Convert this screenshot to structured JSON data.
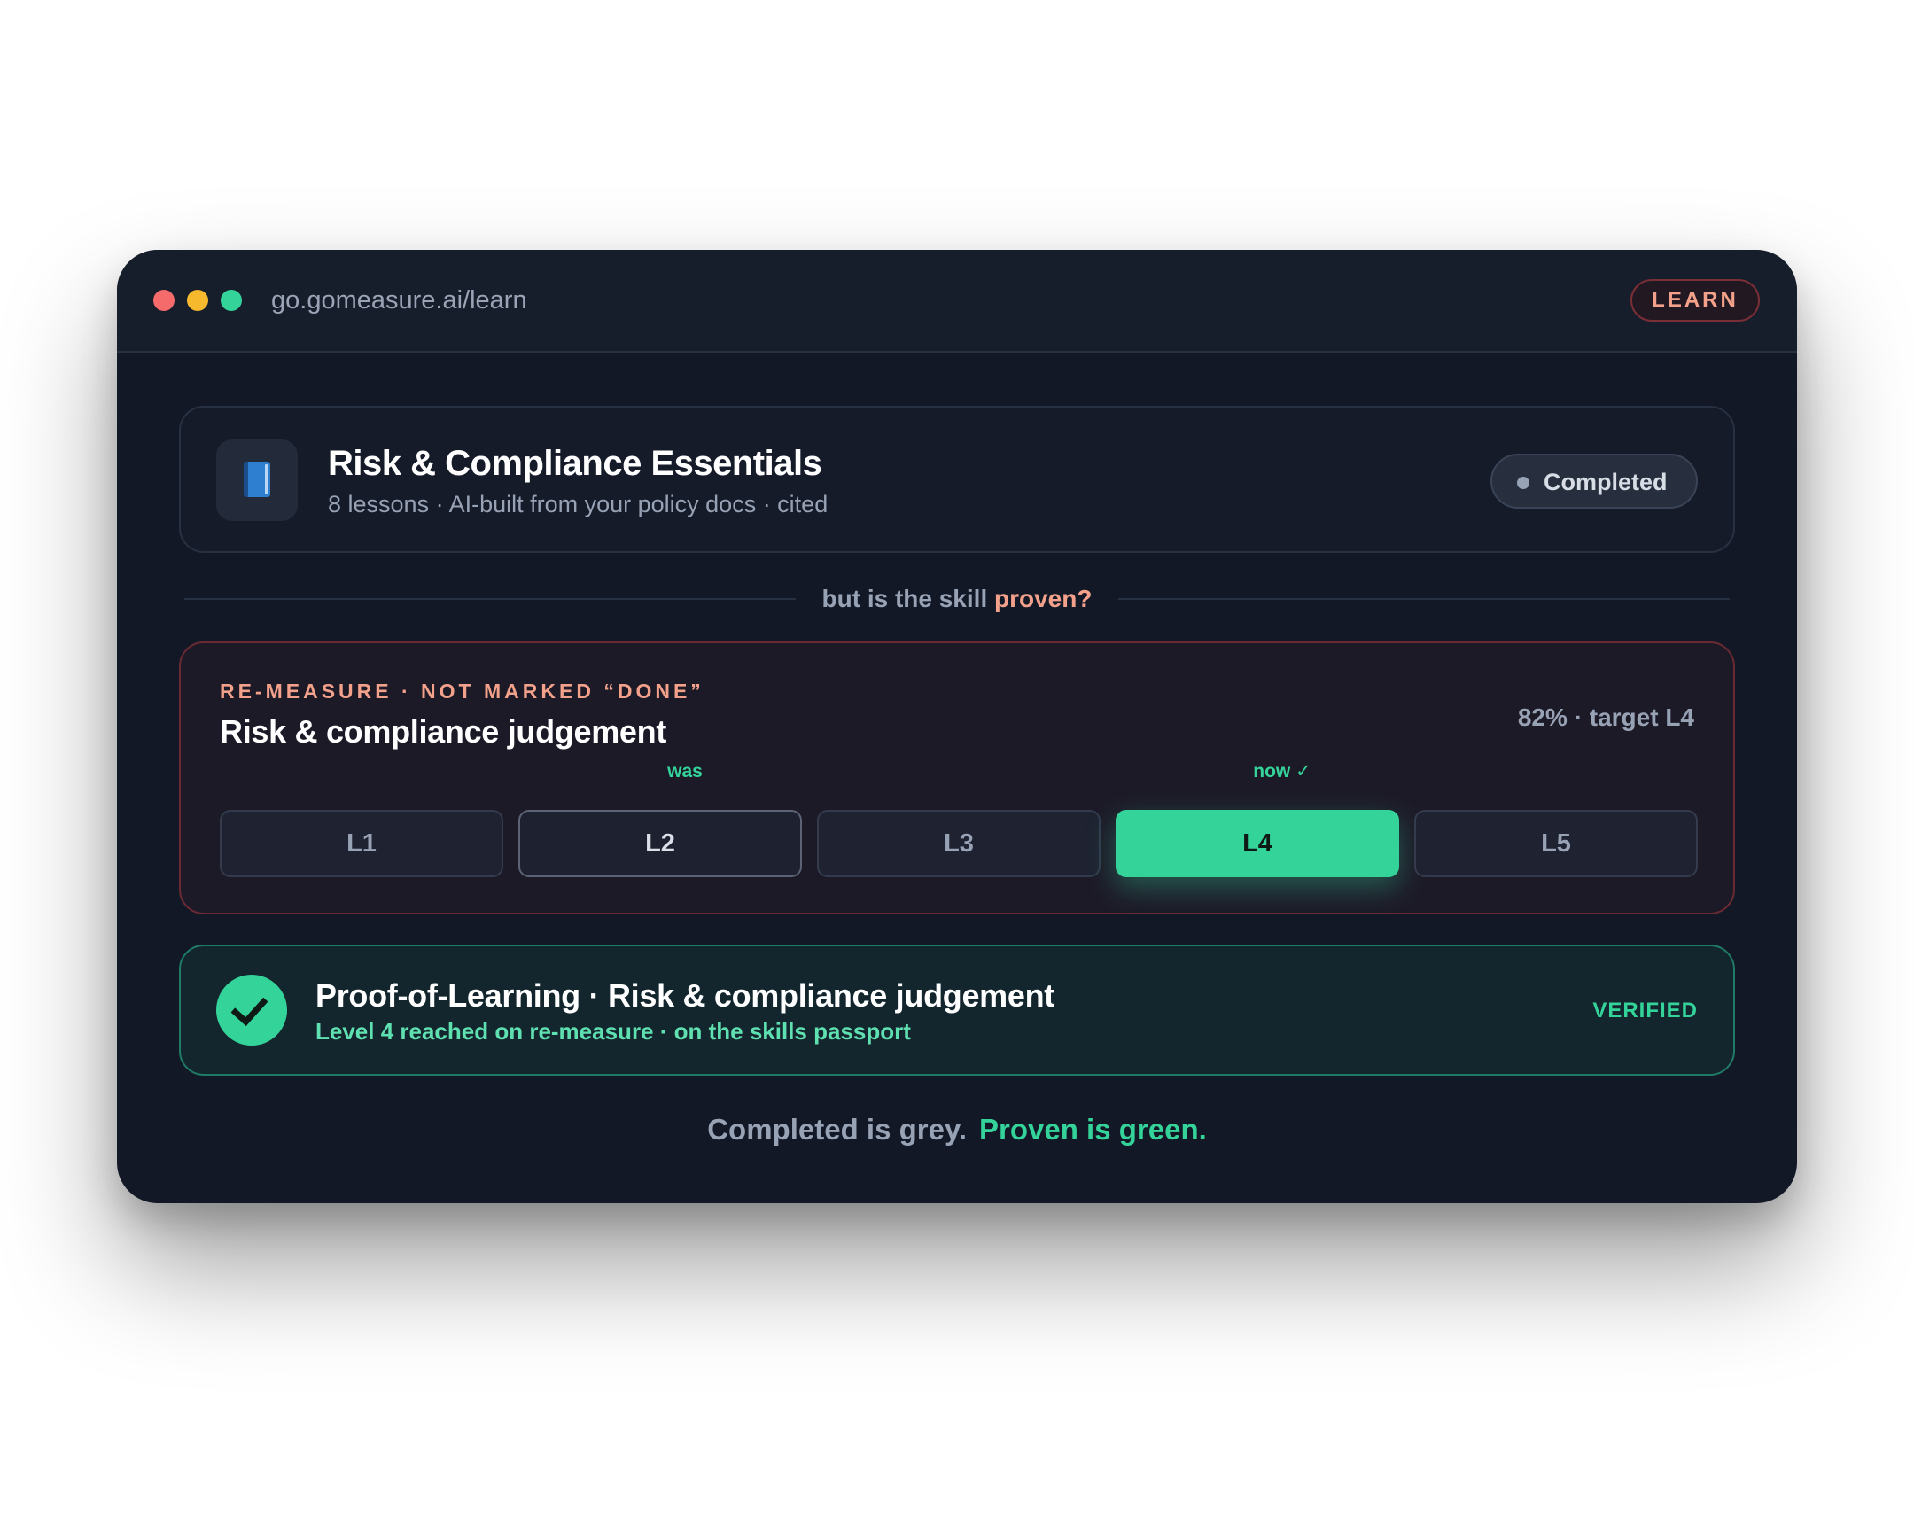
{
  "window": {
    "url": "go.gomeasure.ai/learn",
    "badge": "LEARN"
  },
  "course": {
    "icon": "book-icon",
    "title": "Risk & Compliance Essentials",
    "subtitle": "8 lessons · AI-built from your policy docs · cited",
    "status": "Completed"
  },
  "divider": {
    "text": "but is the skill",
    "accent": "proven?"
  },
  "measure": {
    "eyebrow": "RE-MEASURE · NOT MARKED “DONE”",
    "title": "Risk & compliance judgement",
    "score": "82% · target L4",
    "was_label": "was",
    "now_label": "now ✓",
    "levels": [
      "L1",
      "L2",
      "L3",
      "L4",
      "L5"
    ],
    "was_level": "L2",
    "now_level": "L4"
  },
  "proof": {
    "icon": "check-icon",
    "title": "Proof-of-Learning · Risk & compliance judgement",
    "subtitle": "Level 4 reached on re-measure · on the skills passport",
    "badge": "VERIFIED"
  },
  "tagline": {
    "grey": "Completed is grey.",
    "green": "Proven is green."
  },
  "colors": {
    "accent_green": "#34d39a",
    "accent_salmon": "#f3a18a",
    "muted": "#98a2b5",
    "background": "#121826"
  }
}
